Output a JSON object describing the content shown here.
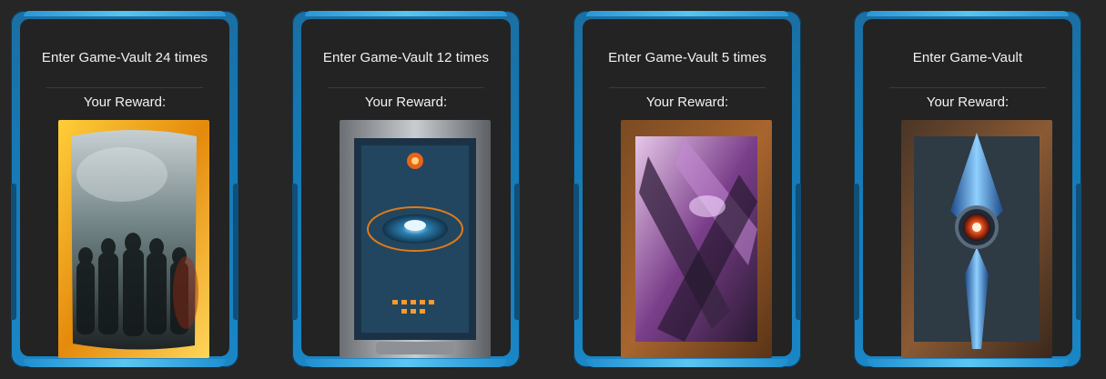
{
  "cards": [
    {
      "title": "Enter Game-Vault 24 times",
      "reward_label": "Your Reward:",
      "art": "golden-frame-shadow-figures-card"
    },
    {
      "title": "Enter Game-Vault 12 times",
      "reward_label": "Your Reward:",
      "art": "sci-fi-reactor-core-card"
    },
    {
      "title": "Enter Game-Vault 5 times",
      "reward_label": "Your Reward:",
      "art": "purple-crystal-vortex-card"
    },
    {
      "title": "Enter Game-Vault",
      "reward_label": "Your Reward:",
      "art": "blue-crystal-relic-card"
    }
  ],
  "colors": {
    "background": "#262626",
    "frame_blue": "#1a86c6",
    "frame_highlight": "#5cc6f2",
    "panel": "#232323",
    "text": "#f2f2f2"
  }
}
